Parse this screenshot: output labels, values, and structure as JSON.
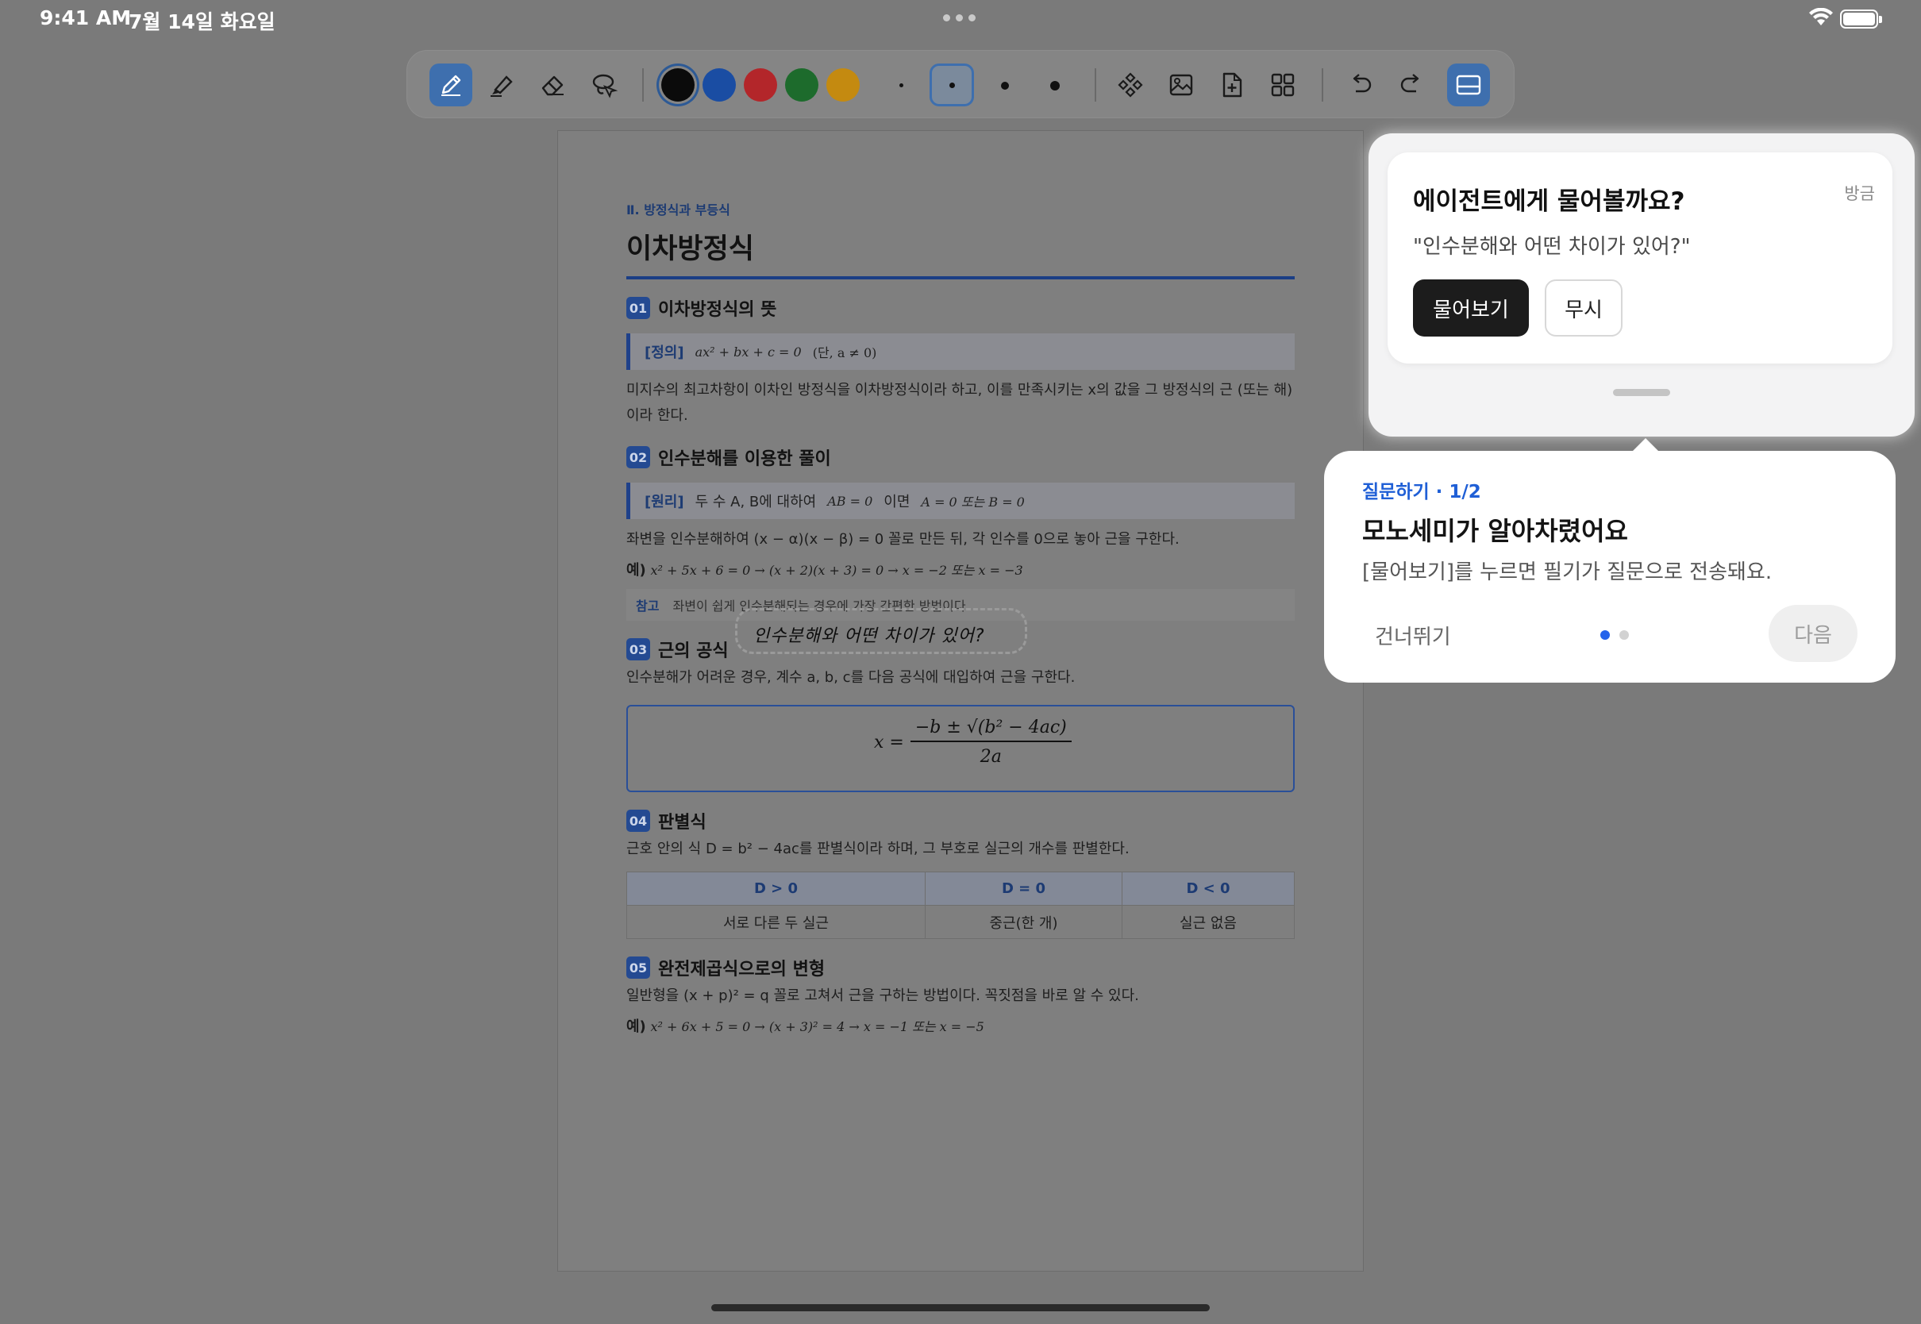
{
  "status_bar": {
    "time": "9:41 AM",
    "date": "7월 14일 화요일"
  },
  "toolbar": {
    "tools": [
      "pen-icon",
      "highlighter-icon",
      "eraser-icon",
      "lasso-icon"
    ],
    "colors": [
      "#0b0b0b",
      "#1a4da3",
      "#b3262a",
      "#1d6b2c",
      "#c48a10"
    ],
    "selected_color": "#0b0b0b",
    "insert_tools": [
      "shapes-icon",
      "image-icon",
      "add-page-icon",
      "grid-icon"
    ],
    "history": [
      "undo-icon",
      "redo-icon"
    ],
    "panel_toggle": "panel-toggle-icon",
    "accent": "#3e6fae"
  },
  "document": {
    "chapter": "Ⅱ. 방정식과 부등식",
    "title": "이차방정식",
    "s1": {
      "num": "01",
      "title": "이차방정식의 뜻"
    },
    "def_tag": "[정의]",
    "def_math": "ax² + bx + c = 0",
    "def_cond": "(단, a ≠ 0)",
    "s1_text": "미지수의 최고차항이 이차인 방정식을 이차방정식이라 하고, 이를 만족시키는 x의 값을 그 방정식의 근 (또는 해)이라 한다.",
    "s2": {
      "num": "02",
      "title": "인수분해를 이용한 풀이"
    },
    "prin_tag": "[원리]",
    "prin_text": "두 수 A, B에 대하여",
    "prin_math1": "AB = 0",
    "prin_mid": "이면",
    "prin_math2": "A = 0 또는 B = 0",
    "s2_text": "좌변을 인수분해하여 (x − α)(x − β) = 0 꼴로 만든 뒤, 각 인수를 0으로 놓아 근을 구한다.",
    "ex1_tag": "예)",
    "ex1": "x² + 5x + 6 = 0 → (x + 2)(x + 3) = 0 → x = −2 또는 x = −3",
    "note_tag": "참고",
    "note_text": "좌변이 쉽게 인수분해되는 경우에 가장 간편한 방법이다.",
    "s3": {
      "num": "03",
      "title": "근의 공식"
    },
    "s3_text": "인수분해가 어려운 경우, 계수 a, b, c를 다음 공식에 대입하여 근을 구한다.",
    "formula_lhs": "x =",
    "formula_num": "−b ± √(b² − 4ac)",
    "formula_den": "2a",
    "s4": {
      "num": "04",
      "title": "판별식"
    },
    "s4_text": "근호 안의 식 D = b² − 4ac를 판별식이라 하며, 그 부호로 실근의 개수를 판별한다.",
    "table": {
      "headers": [
        "D > 0",
        "D = 0",
        "D < 0"
      ],
      "row": [
        "서로 다른 두 실근",
        "중근(한 개)",
        "실근 없음"
      ]
    },
    "s5": {
      "num": "05",
      "title": "완전제곱식으로의 변형"
    },
    "s5_text": "일반형을 (x + p)² = q 꼴로 고쳐서 근을 구하는 방법이다. 꼭짓점을 바로 알 수 있다.",
    "ex2_tag": "예)",
    "ex2": "x² + 6x + 5 = 0 → (x + 3)² = 4 → x = −1 또는 x = −5",
    "handwriting": "인수분해와 어떤 차이가 있어?"
  },
  "agent": {
    "title": "에이전트에게 물어볼까요?",
    "time": "방금",
    "quote": "\"인수분해와 어떤 차이가 있어?\"",
    "ask_label": "물어보기",
    "ignore_label": "무시"
  },
  "tooltip": {
    "step": "질문하기 · 1/2",
    "title": "모노세미가 알아차렸어요",
    "desc": "[물어보기]를 누르면 필기가 질문으로 전송돼요.",
    "skip_label": "건너뛰기",
    "next_label": "다음",
    "page_current": 1,
    "page_total": 2
  }
}
